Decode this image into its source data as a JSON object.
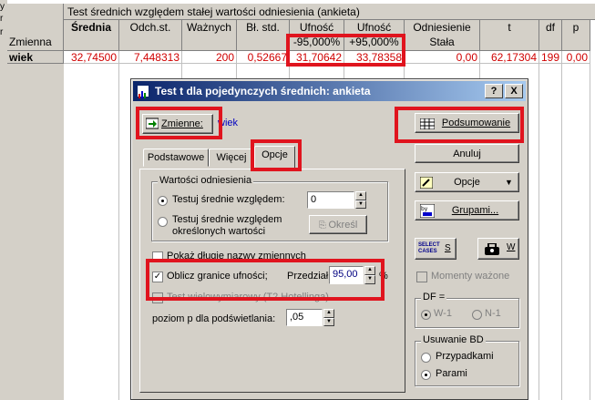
{
  "sheet": {
    "title": "Test średnich względem stałej wartości odniesienia (ankieta)",
    "left_fragment": [
      "y",
      "r",
      "r"
    ],
    "row_header_label": "Zmienna",
    "columns": [
      {
        "h1": "Średnia",
        "h2": ""
      },
      {
        "h1": "Odch.st.",
        "h2": ""
      },
      {
        "h1": "Ważnych",
        "h2": ""
      },
      {
        "h1": "Bł. std.",
        "h2": ""
      },
      {
        "h1": "Ufność",
        "h2": "-95,000%"
      },
      {
        "h1": "Ufność",
        "h2": "+95,000%"
      },
      {
        "h1": "Odniesienie",
        "h2": "Stała"
      },
      {
        "h1": "t",
        "h2": ""
      },
      {
        "h1": "df",
        "h2": ""
      },
      {
        "h1": "p",
        "h2": ""
      }
    ],
    "row": {
      "name": "wiek",
      "values": [
        "32,74500",
        "7,448313",
        "200",
        "0,52667",
        "31,70642",
        "33,78358",
        "0,00",
        "62,17304",
        "199",
        "0,00"
      ]
    }
  },
  "dialog": {
    "title": "Test t dla pojedynczych średnich: ankieta",
    "help_btn": "?",
    "close_btn": "X",
    "variables_btn": "Zmienne:",
    "variables_value": "wiek",
    "summary_btn": "Podsumowanie",
    "cancel_btn": "Anuluj",
    "options_btn": "Opcje",
    "groups_btn": "Grupami...",
    "select_cases": "SELECT CASES",
    "select_s": "S",
    "weight_w": "W",
    "tabs": [
      "Podstawowe",
      "Więcej",
      "Opcje"
    ],
    "ref_group": "Wartości odniesienia",
    "ref_opt1": "Testuj średnie względem:",
    "ref_opt1_value": "0",
    "ref_opt2_line1": "Testuj średnie względem",
    "ref_opt2_line2": "określonych wartości",
    "specify_btn": "Określ",
    "long_names": "Pokaż długie nazwy zmiennych",
    "conf_limits": "Oblicz granice ufności;",
    "interval_label": "Przedział",
    "interval_value": "95,00",
    "percent": "%",
    "multivariate": "Test wielowymiarowy (T2 Hotellinga)",
    "p_level_label": "poziom p dla podświetlania:",
    "p_level_value": ",05",
    "moments_weighted": "Momenty ważone",
    "df_group": "DF =",
    "df_opt1": "W-1",
    "df_opt2": "N-1",
    "md_group": "Usuwanie BD",
    "md_opt1": "Przypadkami",
    "md_opt2": "Parami"
  },
  "colors": {
    "highlight_red": "#e0141e",
    "value_red": "#d00000",
    "window_face": "#d4d0c8",
    "title_blue": "#0a246a"
  }
}
